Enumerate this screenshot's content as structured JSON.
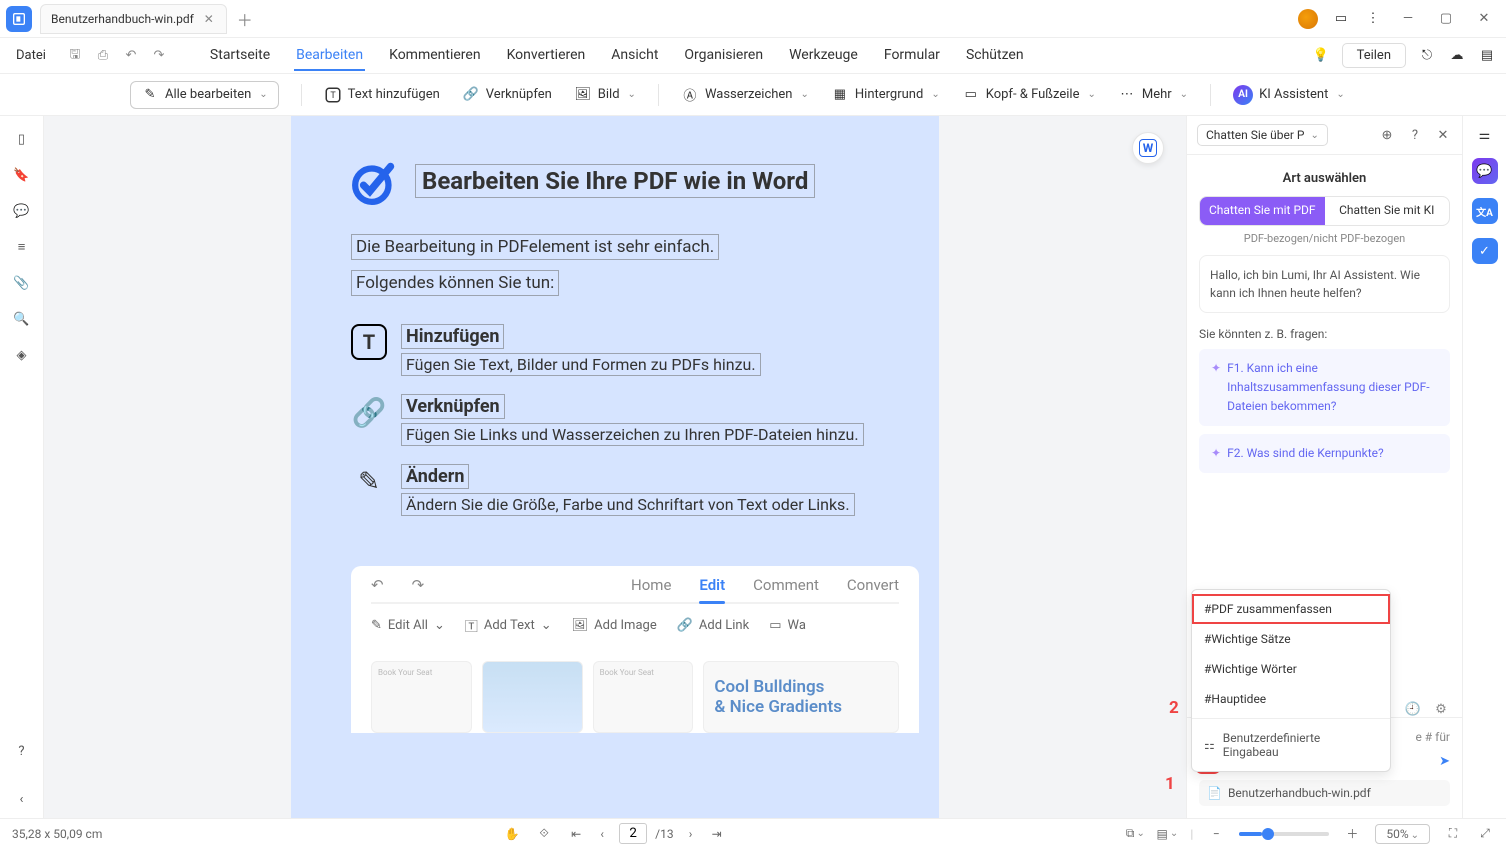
{
  "tab": {
    "title": "Benutzerhandbuch-win.pdf"
  },
  "menubar": {
    "file": "Datei",
    "tabs": [
      "Startseite",
      "Bearbeiten",
      "Kommentieren",
      "Konvertieren",
      "Ansicht",
      "Organisieren",
      "Werkzeuge",
      "Formular",
      "Schützen"
    ],
    "active_idx": 1,
    "share": "Teilen"
  },
  "ribbon": {
    "editall": "Alle bearbeiten",
    "addtext": "Text hinzufügen",
    "link": "Verknüpfen",
    "image": "Bild",
    "watermark": "Wasserzeichen",
    "background": "Hintergrund",
    "headerfooter": "Kopf- & Fußzeile",
    "more": "Mehr",
    "assistant": "KI Assistent"
  },
  "doc": {
    "title": "Bearbeiten Sie Ihre PDF wie in Word",
    "p1": "Die Bearbeitung in PDFelement ist sehr einfach.",
    "p2": "Folgendes können Sie tun:",
    "f1t": "Hinzufügen",
    "f1d": "Fügen Sie Text, Bilder und Formen zu PDFs hinzu.",
    "f2t": "Verknüpfen",
    "f2d": "Fügen Sie Links und Wasserzeichen zu Ihren PDF-Dateien hinzu.",
    "f3t": "Ändern",
    "f3d": "Ändern Sie die Größe, Farbe und Schriftart von Text oder Links.",
    "inner": {
      "home": "Home",
      "edit": "Edit",
      "comment": "Comment",
      "convert": "Convert",
      "editall": "Edit All",
      "addtext": "Add Text",
      "addimage": "Add Image",
      "addlink": "Add Link",
      "wa": "Wa"
    },
    "preview": {
      "t1": "Cool Bulldings",
      "t2": "& Nice Gradients"
    }
  },
  "ai": {
    "selector": "Chatten Sie über P",
    "subtitle": "Art auswählen",
    "toggle1": "Chatten Sie mit PDF",
    "toggle2": "Chatten Sie mit KI",
    "note": "PDF-bezogen/nicht PDF-bezogen",
    "greeting": "Hallo, ich bin Lumi, Ihr AI Assistent. Wie kann ich Ihnen heute helfen?",
    "sugg_title": "Sie könnten z. B. fragen:",
    "sugg1": "F1. Kann ich eine Inhaltszusammenfassung dieser PDF-Dateien bekommen?",
    "sugg2": "F2. Was sind die Kernpunkte?",
    "hint": "e # für",
    "attached": "Benutzerhandbuch-win.pdf",
    "popup": {
      "i1": "#PDF zusammenfassen",
      "i2": "#Wichtige Sätze",
      "i3": "#Wichtige Wörter",
      "i4": "#Hauptidee",
      "custom": "Benutzerdefinierte Eingabeau"
    }
  },
  "status": {
    "dims": "35,28 x 50,09 cm",
    "page": "2",
    "total": "/13",
    "zoom": "50%"
  },
  "annot": {
    "n1": "1",
    "n2": "2"
  }
}
